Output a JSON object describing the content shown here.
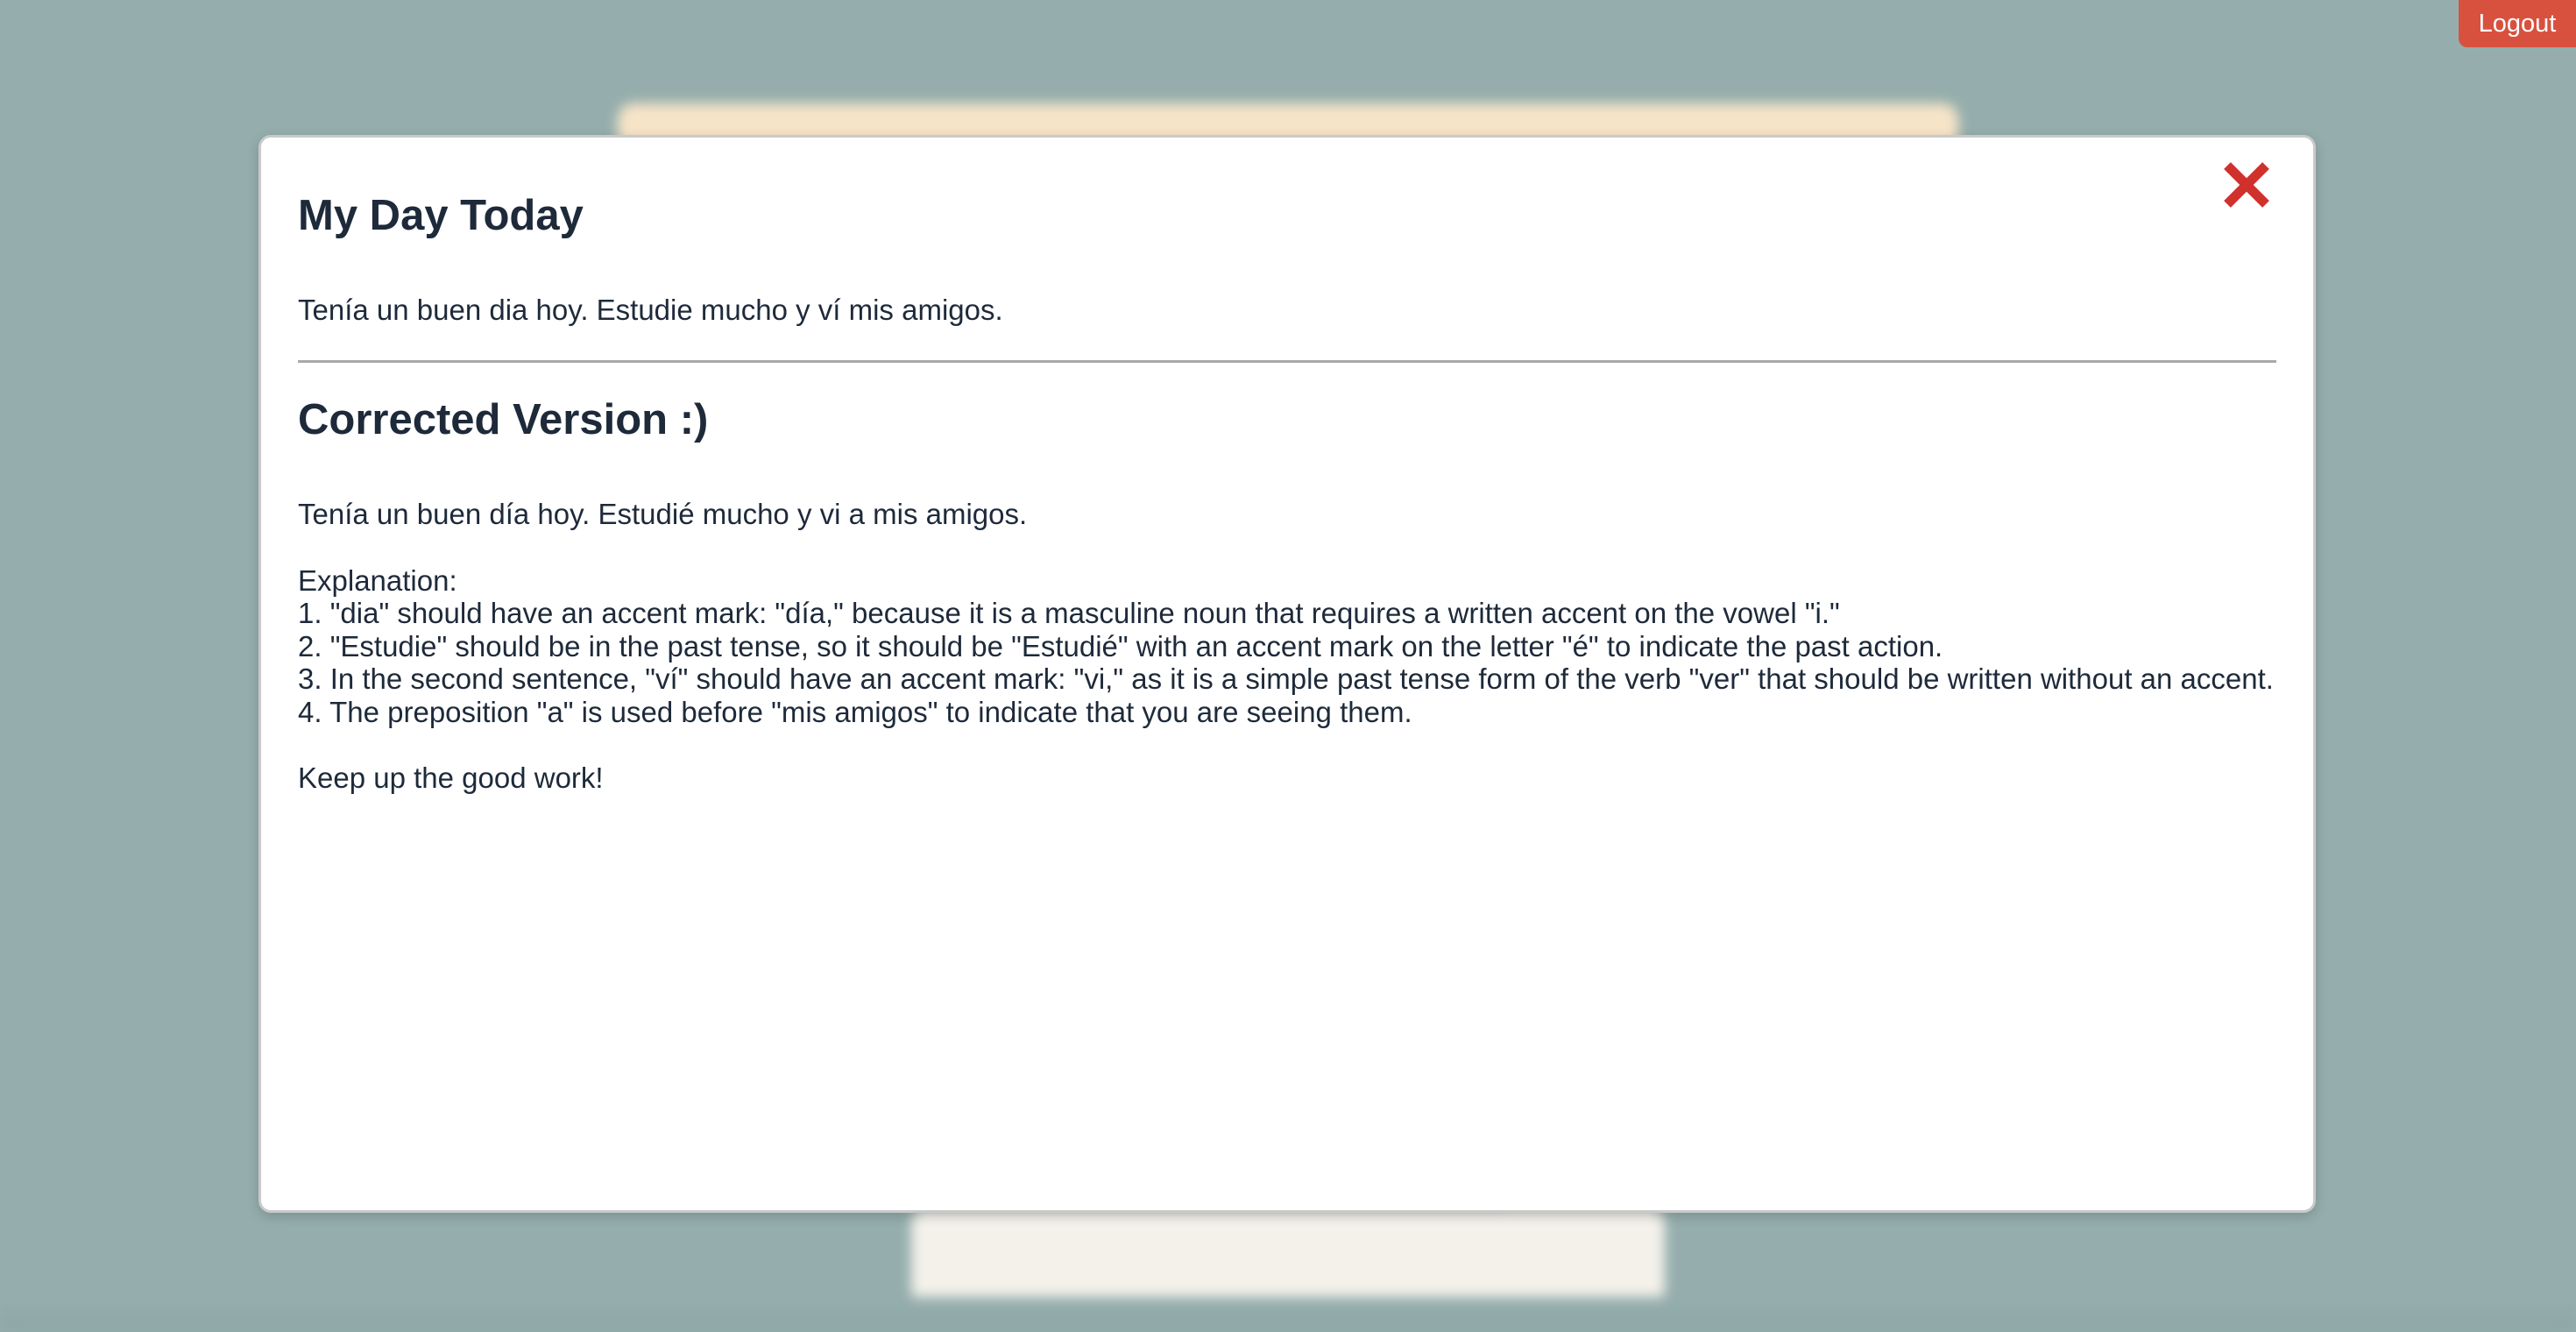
{
  "header": {
    "logout_label": "Logout"
  },
  "modal": {
    "entry_title": "My Day Today",
    "entry_text": "Tenía un buen dia hoy. Estudie mucho y ví mis amigos.",
    "corrected_heading": "Corrected Version :)",
    "corrected_text": "Tenía un buen día hoy. Estudié mucho y vi a mis amigos.",
    "explanation_label": "Explanation:",
    "explanation_items": [
      "1. \"dia\" should have an accent mark: \"día,\" because it is a masculine noun that requires a written accent on the vowel \"i.\"",
      "2. \"Estudie\" should be in the past tense, so it should be \"Estudié\" with an accent mark on the letter \"é\" to indicate the past action.",
      "3. In the second sentence, \"ví\" should have an accent mark: \"vi,\" as it is a simple past tense form of the verb \"ver\" that should be written without an accent.",
      "4. The preposition \"a\" is used before \"mis amigos\" to indicate that you are seeing them."
    ],
    "closing": "Keep up the good work!",
    "close_icon": "close-icon"
  },
  "colors": {
    "backdrop": "#95aead",
    "logout_button": "#d8513f",
    "close_icon": "#d0312d",
    "text": "#1e2a3a"
  }
}
